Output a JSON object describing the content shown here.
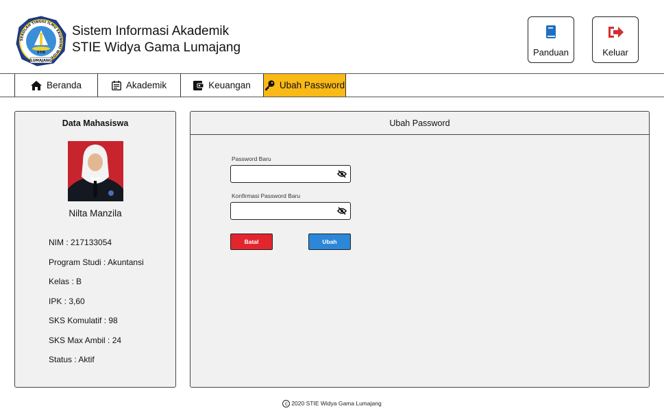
{
  "header": {
    "title_line1": "Sistem Informasi Akademik",
    "title_line2": "STIE Widya Gama Lumajang",
    "logo": {
      "icon": "university-seal-icon",
      "ring_text": "SEKOLAH TINGGI ILMU EKONOMI WIDYA GAMA",
      "center_text": "STIE",
      "bottom_text": "LUMAJANG"
    },
    "buttons": [
      {
        "label": "Panduan",
        "icon": "book-icon",
        "color": "#1e6fc2"
      },
      {
        "label": "Keluar",
        "icon": "sign-out-icon",
        "color": "#d32f2f"
      }
    ]
  },
  "nav": {
    "tabs": [
      {
        "label": "Beranda",
        "icon": "home-icon"
      },
      {
        "label": "Akademik",
        "icon": "calendar-list-icon"
      },
      {
        "label": "Keuangan",
        "icon": "wallet-icon"
      },
      {
        "label": "Ubah Password",
        "icon": "key-icon",
        "active": true
      }
    ],
    "active_color": "#f9b916"
  },
  "student": {
    "panel_title": "Data Mahasiswa",
    "name": "Nilta Manzila",
    "info": [
      "NIM : 217133054",
      "Program Studi : Akuntansi",
      "Kelas : B",
      "IPK : 3,60",
      "SKS Komulatif : 98",
      "SKS Max Ambil : 24",
      "Status : Aktif"
    ]
  },
  "form": {
    "title": "Ubah Password",
    "new_password_label": "Password Baru",
    "new_password_value": "",
    "confirm_password_label": "Konfirmasi Password Baru",
    "confirm_password_value": "",
    "cancel_label": "Batal",
    "submit_label": "Ubah",
    "cancel_color": "#e3262e",
    "submit_color": "#2c87d8"
  },
  "footer": {
    "text": "2020 STIE Widya Gama Lumajang"
  }
}
